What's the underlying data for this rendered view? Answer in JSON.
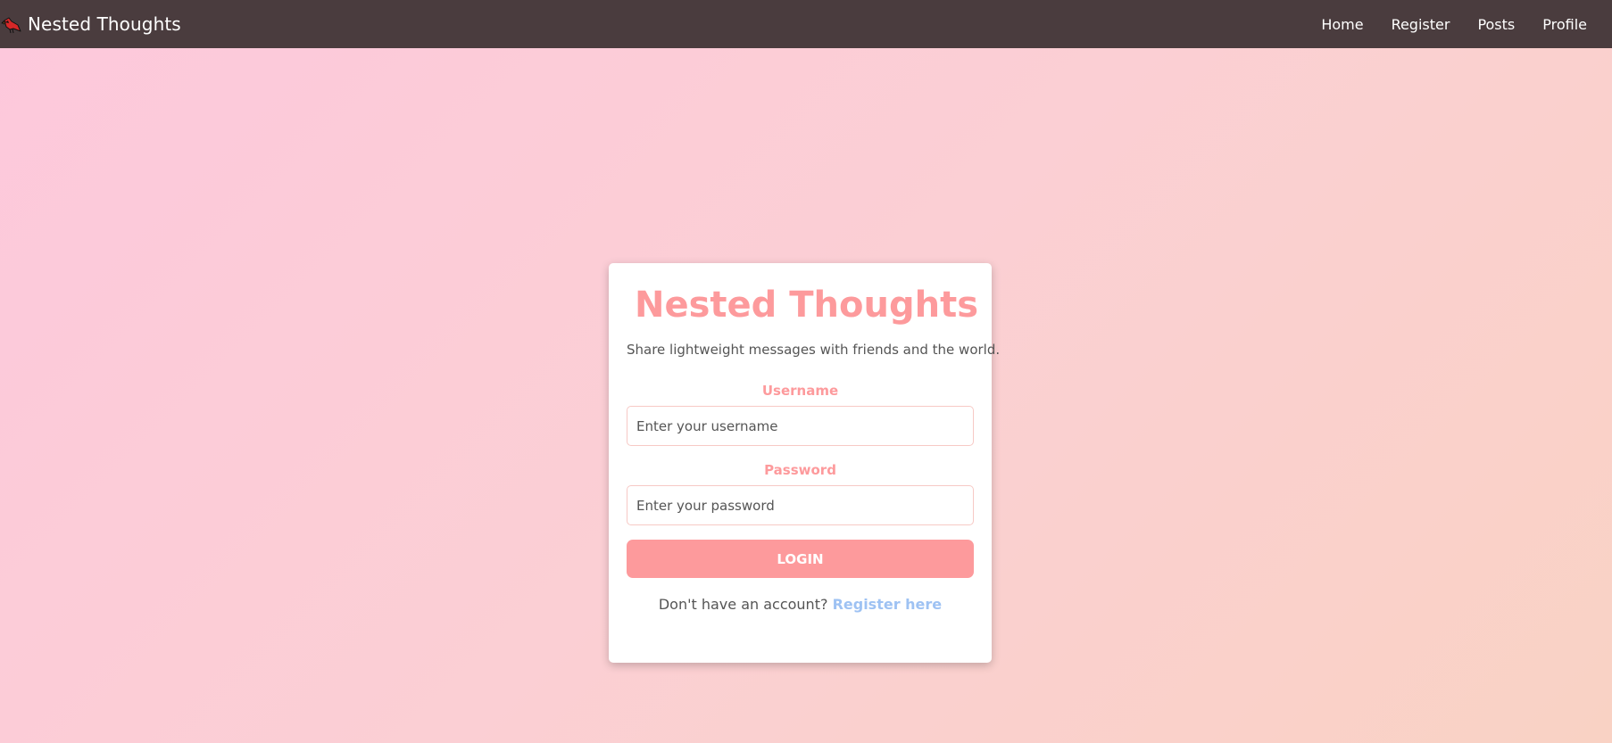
{
  "navbar": {
    "brand_icon": "cardinal-bird-icon",
    "brand_name": "Nested Thoughts",
    "links": [
      "Home",
      "Register",
      "Posts",
      "Profile"
    ],
    "background": "#4a3c3e"
  },
  "login_card": {
    "logo_icon": "cardinal-bird-icon",
    "title": "Nested Thoughts",
    "tagline": "Share lightweight messages with friends and the world.",
    "username_label": "Username",
    "username_placeholder": "Enter your username",
    "username_value": "",
    "password_label": "Password",
    "password_placeholder": "Enter your password",
    "password_value": "",
    "login_button_label": "LOGIN",
    "register_prompt": "Don't have an account?",
    "register_link_label": "Register here"
  },
  "colors": {
    "accent": "#fd9a9c",
    "link": "#9ec2f3",
    "background_start": "#fdc8dc",
    "background_end": "#f9d2c4"
  }
}
